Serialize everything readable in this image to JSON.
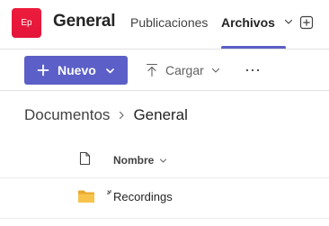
{
  "header": {
    "team_avatar_text": "Ep",
    "team_avatar_color": "#e8193c",
    "channel_title": "General",
    "tabs": [
      {
        "label": "Publicaciones",
        "active": false
      },
      {
        "label": "Archivos",
        "active": true
      }
    ],
    "accent_color": "#5b5fc7",
    "icons": {
      "tab_dropdown": "chevron-down-icon",
      "add_tab": "add-tab-icon"
    }
  },
  "toolbar": {
    "new_label": "Nuevo",
    "upload_label": "Cargar",
    "icons": {
      "new": "plus-icon",
      "new_dropdown": "chevron-down-icon",
      "upload": "upload-icon",
      "upload_dropdown": "chevron-down-icon",
      "more": "more-horizontal-icon"
    }
  },
  "breadcrumb": {
    "items": [
      "Documentos",
      "General"
    ],
    "separator_icon": "chevron-right-icon"
  },
  "table": {
    "columns": [
      {
        "type": "file-type-icon"
      },
      {
        "label": "Nombre",
        "sort_icon": "chevron-down-icon"
      }
    ],
    "rows": [
      {
        "name": "Recordings",
        "type": "folder",
        "icon": "folder-icon",
        "new_indicator": "sparkle-icon"
      }
    ],
    "folder_color": "#f4b73e"
  }
}
